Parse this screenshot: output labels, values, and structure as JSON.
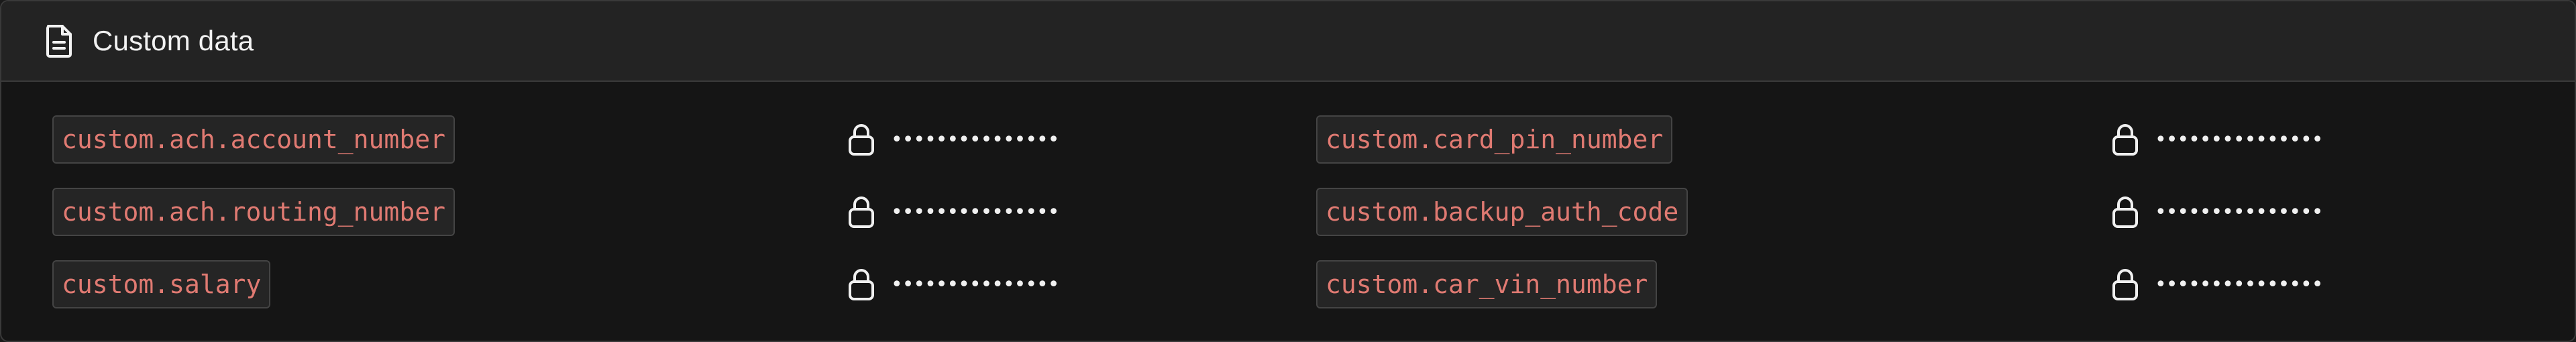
{
  "header": {
    "title": "Custom data",
    "icon": "document-icon"
  },
  "fields": [
    {
      "key": "custom.ach.account_number",
      "value": "•••••••••••••••",
      "icon": "lock-icon"
    },
    {
      "key": "custom.card_pin_number",
      "value": "•••••••••••••••",
      "icon": "lock-icon"
    },
    {
      "key": "custom.ach.routing_number",
      "value": "•••••••••••••••",
      "icon": "lock-icon"
    },
    {
      "key": "custom.backup_auth_code",
      "value": "•••••••••••••••",
      "icon": "lock-icon"
    },
    {
      "key": "custom.salary",
      "value": "•••••••••••••••",
      "icon": "lock-icon"
    },
    {
      "key": "custom.car_vin_number",
      "value": "•••••••••••••••",
      "icon": "lock-icon"
    }
  ],
  "colors": {
    "key_text": "#e07a72",
    "panel_bg": "#151515",
    "header_bg": "#232323",
    "value_text": "#f0f0f0"
  }
}
